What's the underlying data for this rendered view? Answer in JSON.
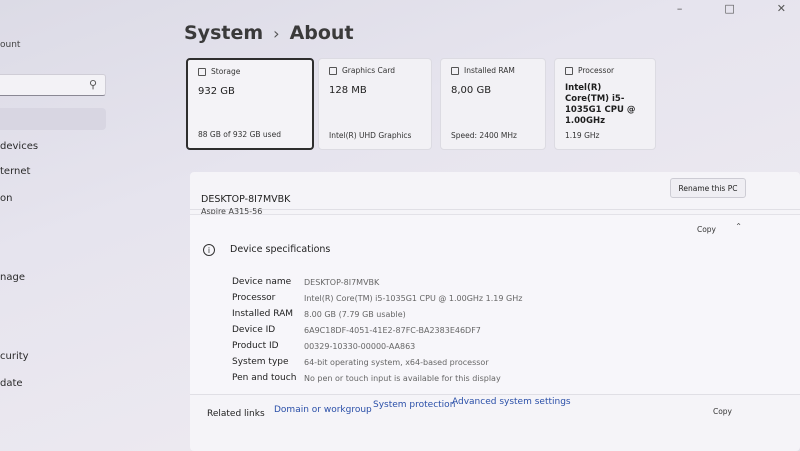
{
  "window": {
    "controls": [
      "–",
      "□",
      "✕"
    ]
  },
  "sidebar": {
    "user_partial": "ount",
    "search": {
      "placeholder": ""
    },
    "items": [
      {
        "label": "devices",
        "top": 0
      },
      {
        "label": "ternet",
        "top": 0
      },
      {
        "label": "on",
        "top": 0
      },
      {
        "label": "nage",
        "top": 0
      },
      {
        "label": "curity",
        "top": 0
      },
      {
        "label": "date",
        "top": 0
      }
    ]
  },
  "breadcrumb": {
    "parent": "System",
    "separator": "›",
    "current": "About"
  },
  "cards": [
    {
      "title": "Storage",
      "value": "932 GB",
      "detail": "88 GB of 932 GB used",
      "selected": true
    },
    {
      "title": "Graphics Card",
      "value": "128 MB",
      "detail": "Intel(R) UHD Graphics"
    },
    {
      "title": "Installed RAM",
      "value": "8,00 GB",
      "detail": "Speed: 2400 MHz"
    },
    {
      "title": "Processor",
      "value": "Intel(R) Core(TM) i5-1035G1 CPU @ 1.00GHz",
      "detail": "1.19 GHz"
    }
  ],
  "device": {
    "name": "DESKTOP-8I7MVBK",
    "model": "Aspire A315-56",
    "rename_label": "Rename this PC"
  },
  "specs": {
    "title": "Device specifications",
    "copy_label": "Copy",
    "rows": [
      {
        "label": "Device name",
        "value": "DESKTOP-8I7MVBK"
      },
      {
        "label": "Processor",
        "value": "Intel(R) Core(TM) i5-1035G1 CPU @ 1.00GHz   1.19 GHz"
      },
      {
        "label": "Installed RAM",
        "value": "8.00 GB (7.79 GB usable)"
      },
      {
        "label": "Device ID",
        "value": "6A9C18DF-4051-41E2-87FC-BA2383E46DF7"
      },
      {
        "label": "Product ID",
        "value": "00329-10330-00000-AA863"
      },
      {
        "label": "System type",
        "value": "64-bit operating system, x64-based processor"
      },
      {
        "label": "Pen and touch",
        "value": "No pen or touch input is available for this display"
      }
    ]
  },
  "related": {
    "label": "Related links",
    "links": [
      "Domain or workgroup",
      "System protection",
      "Advanced system settings"
    ],
    "copy_label": "Copy"
  }
}
